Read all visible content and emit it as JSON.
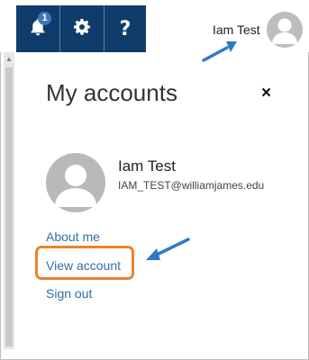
{
  "header": {
    "notifications": {
      "icon": "bell-icon",
      "count": "1"
    },
    "settings": {
      "icon": "gear-icon"
    },
    "help": {
      "label": "?"
    },
    "user_name": "Iam Test",
    "avatar": "person-avatar-icon"
  },
  "panel": {
    "title": "My accounts",
    "close_label": "×",
    "user": {
      "name": "Iam Test",
      "email": "IAM_TEST@williamjames.edu"
    },
    "links": {
      "about_me": "About me",
      "view_account": "View account",
      "sign_out": "Sign out"
    }
  },
  "annotations": {
    "arrow_color": "#2f79c9",
    "highlight_color": "#e8852c"
  },
  "colors": {
    "nav_bg": "#0f3c6b",
    "link": "#2e6fa7"
  }
}
